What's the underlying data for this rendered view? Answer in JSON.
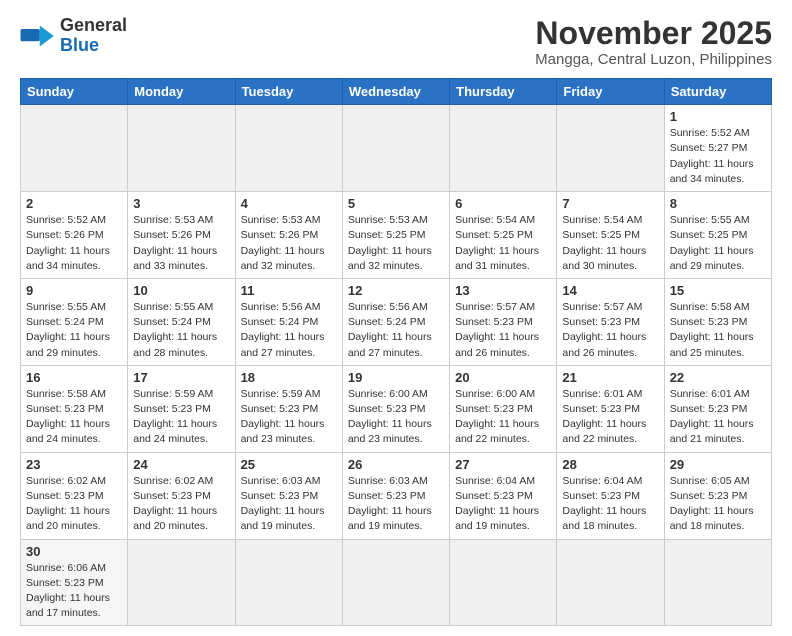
{
  "header": {
    "logo_general": "General",
    "logo_blue": "Blue",
    "title": "November 2025",
    "subtitle": "Mangga, Central Luzon, Philippines"
  },
  "weekdays": [
    "Sunday",
    "Monday",
    "Tuesday",
    "Wednesday",
    "Thursday",
    "Friday",
    "Saturday"
  ],
  "weeks": [
    [
      {
        "day": "",
        "info": "",
        "empty": true
      },
      {
        "day": "",
        "info": "",
        "empty": true
      },
      {
        "day": "",
        "info": "",
        "empty": true
      },
      {
        "day": "",
        "info": "",
        "empty": true
      },
      {
        "day": "",
        "info": "",
        "empty": true
      },
      {
        "day": "",
        "info": "",
        "empty": true
      },
      {
        "day": "1",
        "info": "Sunrise: 5:52 AM\nSunset: 5:27 PM\nDaylight: 11 hours\nand 34 minutes.",
        "empty": false
      }
    ],
    [
      {
        "day": "2",
        "info": "Sunrise: 5:52 AM\nSunset: 5:26 PM\nDaylight: 11 hours\nand 34 minutes.",
        "empty": false
      },
      {
        "day": "3",
        "info": "Sunrise: 5:53 AM\nSunset: 5:26 PM\nDaylight: 11 hours\nand 33 minutes.",
        "empty": false
      },
      {
        "day": "4",
        "info": "Sunrise: 5:53 AM\nSunset: 5:26 PM\nDaylight: 11 hours\nand 32 minutes.",
        "empty": false
      },
      {
        "day": "5",
        "info": "Sunrise: 5:53 AM\nSunset: 5:25 PM\nDaylight: 11 hours\nand 32 minutes.",
        "empty": false
      },
      {
        "day": "6",
        "info": "Sunrise: 5:54 AM\nSunset: 5:25 PM\nDaylight: 11 hours\nand 31 minutes.",
        "empty": false
      },
      {
        "day": "7",
        "info": "Sunrise: 5:54 AM\nSunset: 5:25 PM\nDaylight: 11 hours\nand 30 minutes.",
        "empty": false
      },
      {
        "day": "8",
        "info": "Sunrise: 5:55 AM\nSunset: 5:25 PM\nDaylight: 11 hours\nand 29 minutes.",
        "empty": false
      }
    ],
    [
      {
        "day": "9",
        "info": "Sunrise: 5:55 AM\nSunset: 5:24 PM\nDaylight: 11 hours\nand 29 minutes.",
        "empty": false
      },
      {
        "day": "10",
        "info": "Sunrise: 5:55 AM\nSunset: 5:24 PM\nDaylight: 11 hours\nand 28 minutes.",
        "empty": false
      },
      {
        "day": "11",
        "info": "Sunrise: 5:56 AM\nSunset: 5:24 PM\nDaylight: 11 hours\nand 27 minutes.",
        "empty": false
      },
      {
        "day": "12",
        "info": "Sunrise: 5:56 AM\nSunset: 5:24 PM\nDaylight: 11 hours\nand 27 minutes.",
        "empty": false
      },
      {
        "day": "13",
        "info": "Sunrise: 5:57 AM\nSunset: 5:23 PM\nDaylight: 11 hours\nand 26 minutes.",
        "empty": false
      },
      {
        "day": "14",
        "info": "Sunrise: 5:57 AM\nSunset: 5:23 PM\nDaylight: 11 hours\nand 26 minutes.",
        "empty": false
      },
      {
        "day": "15",
        "info": "Sunrise: 5:58 AM\nSunset: 5:23 PM\nDaylight: 11 hours\nand 25 minutes.",
        "empty": false
      }
    ],
    [
      {
        "day": "16",
        "info": "Sunrise: 5:58 AM\nSunset: 5:23 PM\nDaylight: 11 hours\nand 24 minutes.",
        "empty": false
      },
      {
        "day": "17",
        "info": "Sunrise: 5:59 AM\nSunset: 5:23 PM\nDaylight: 11 hours\nand 24 minutes.",
        "empty": false
      },
      {
        "day": "18",
        "info": "Sunrise: 5:59 AM\nSunset: 5:23 PM\nDaylight: 11 hours\nand 23 minutes.",
        "empty": false
      },
      {
        "day": "19",
        "info": "Sunrise: 6:00 AM\nSunset: 5:23 PM\nDaylight: 11 hours\nand 23 minutes.",
        "empty": false
      },
      {
        "day": "20",
        "info": "Sunrise: 6:00 AM\nSunset: 5:23 PM\nDaylight: 11 hours\nand 22 minutes.",
        "empty": false
      },
      {
        "day": "21",
        "info": "Sunrise: 6:01 AM\nSunset: 5:23 PM\nDaylight: 11 hours\nand 22 minutes.",
        "empty": false
      },
      {
        "day": "22",
        "info": "Sunrise: 6:01 AM\nSunset: 5:23 PM\nDaylight: 11 hours\nand 21 minutes.",
        "empty": false
      }
    ],
    [
      {
        "day": "23",
        "info": "Sunrise: 6:02 AM\nSunset: 5:23 PM\nDaylight: 11 hours\nand 20 minutes.",
        "empty": false
      },
      {
        "day": "24",
        "info": "Sunrise: 6:02 AM\nSunset: 5:23 PM\nDaylight: 11 hours\nand 20 minutes.",
        "empty": false
      },
      {
        "day": "25",
        "info": "Sunrise: 6:03 AM\nSunset: 5:23 PM\nDaylight: 11 hours\nand 19 minutes.",
        "empty": false
      },
      {
        "day": "26",
        "info": "Sunrise: 6:03 AM\nSunset: 5:23 PM\nDaylight: 11 hours\nand 19 minutes.",
        "empty": false
      },
      {
        "day": "27",
        "info": "Sunrise: 6:04 AM\nSunset: 5:23 PM\nDaylight: 11 hours\nand 19 minutes.",
        "empty": false
      },
      {
        "day": "28",
        "info": "Sunrise: 6:04 AM\nSunset: 5:23 PM\nDaylight: 11 hours\nand 18 minutes.",
        "empty": false
      },
      {
        "day": "29",
        "info": "Sunrise: 6:05 AM\nSunset: 5:23 PM\nDaylight: 11 hours\nand 18 minutes.",
        "empty": false
      }
    ],
    [
      {
        "day": "30",
        "info": "Sunrise: 6:06 AM\nSunset: 5:23 PM\nDaylight: 11 hours\nand 17 minutes.",
        "empty": false,
        "last": true
      },
      {
        "day": "",
        "info": "",
        "empty": true,
        "last": true
      },
      {
        "day": "",
        "info": "",
        "empty": true,
        "last": true
      },
      {
        "day": "",
        "info": "",
        "empty": true,
        "last": true
      },
      {
        "day": "",
        "info": "",
        "empty": true,
        "last": true
      },
      {
        "day": "",
        "info": "",
        "empty": true,
        "last": true
      },
      {
        "day": "",
        "info": "",
        "empty": true,
        "last": true
      }
    ]
  ]
}
